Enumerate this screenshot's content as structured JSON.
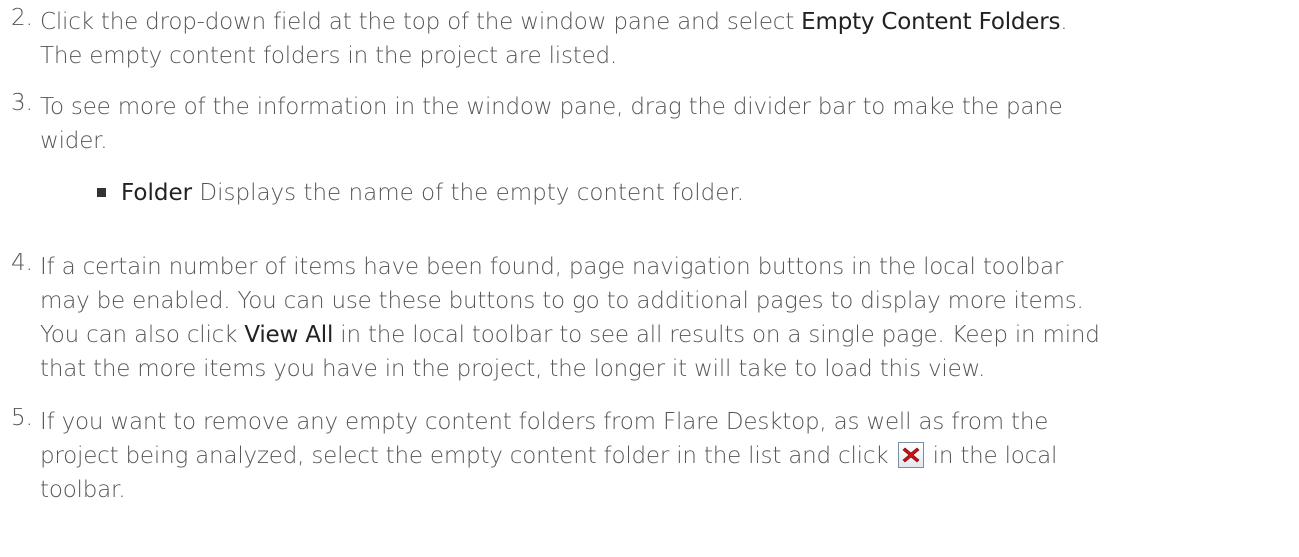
{
  "steps": [
    {
      "number": "2.",
      "text_1": "Click the drop-down field at the top of the window pane and select ",
      "strong_1": "Empty Content Folders",
      "text_2": ".",
      "line_2": "The empty content folders in the project are listed."
    },
    {
      "number": "3.",
      "text_1": "To see more of the information in the window pane, drag the divider bar to make the pane",
      "line_2": "wider."
    },
    {
      "number": "4.",
      "text_1": "If a certain number of items have been found, page navigation buttons in the local toolbar",
      "line_2": "may be enabled. You can use these buttons to go to additional pages to display more items.",
      "line_3_a": "You can also click ",
      "strong_1": "View All",
      "line_3_b": " in the local toolbar to see all results on a single page. Keep in mind",
      "line_4": "that the more items you have in the project, the longer it will take to load this view."
    },
    {
      "number": "5.",
      "text_1": "If you want to remove any empty content folders from Flare Desktop, as well as from the",
      "line_2_a": "project being analyzed, select the empty content folder in the list and click ",
      "line_2_b": " in the local",
      "line_3": "toolbar.",
      "icon": "delete-x-icon"
    }
  ],
  "bullets": [
    {
      "term": "Folder",
      "text": " Displays the name of the empty content folder."
    }
  ],
  "colors": {
    "text": "#555555",
    "emphasis": "#222222",
    "delete_icon": "#cc1111"
  }
}
